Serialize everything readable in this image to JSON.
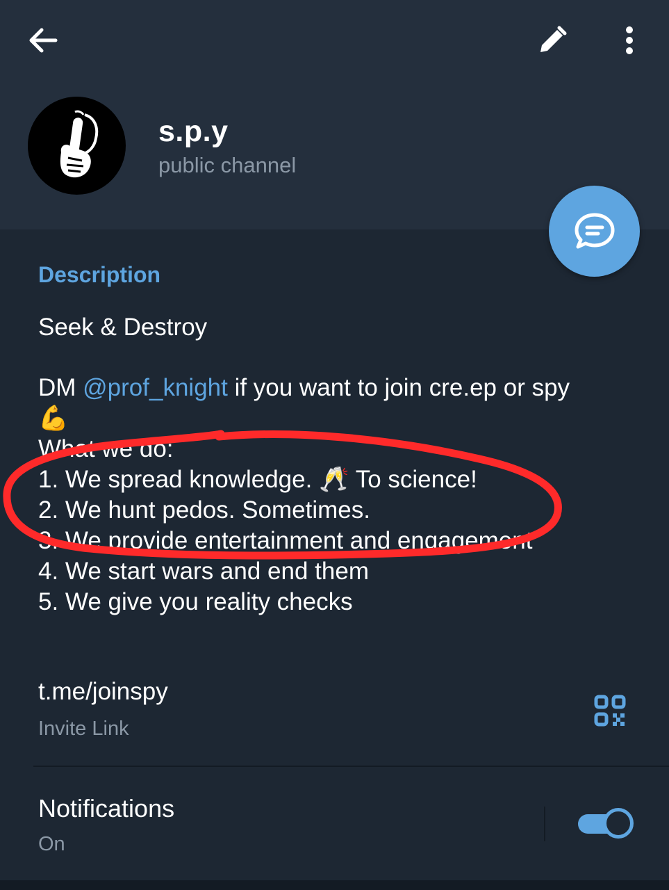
{
  "header": {
    "back_icon": "arrow-back-icon",
    "edit_icon": "pencil-icon",
    "more_icon": "more-vertical-icon",
    "avatar_icon": "shush-hand-icon",
    "channel_name": "s.p.y",
    "channel_type": "public channel"
  },
  "fab_icon": "chat-bubble-icon",
  "description": {
    "title": "Description",
    "tagline": "Seek & Destroy",
    "dm_prefix": "DM ",
    "mention": "@prof_knight",
    "dm_suffix": " if you want to join cre.ep or spy",
    "flex_emoji": "💪",
    "list_heading": "What we do:",
    "item1": "1. We spread knowledge. 🥂 To science!",
    "item2": "2. We hunt pedos. Sometimes.",
    "item3": "3. We provide entertainment and engagement",
    "item4": "4. We start wars and end them",
    "item5": "5. We give you reality checks"
  },
  "invite": {
    "link": "t.me/joinspy",
    "label": "Invite Link",
    "qr_icon": "qr-code-icon"
  },
  "notifications": {
    "title": "Notifications",
    "status": "On",
    "enabled": true
  },
  "colors": {
    "accent": "#5ea5e0",
    "header_bg": "#242f3d",
    "page_bg": "#1d2733",
    "annotation_red": "#ff2a2a"
  }
}
